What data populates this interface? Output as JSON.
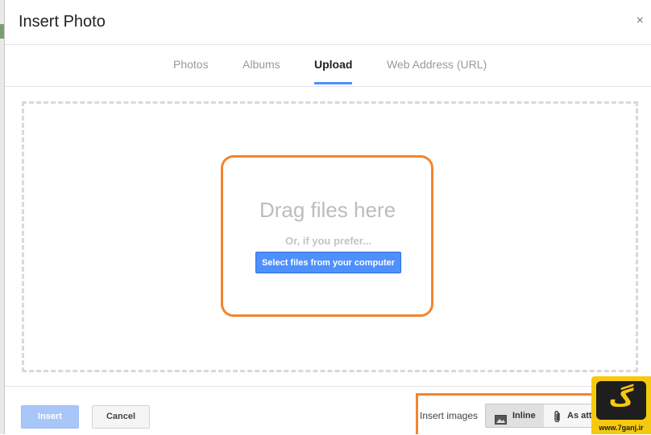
{
  "dialog": {
    "title": "Insert Photo",
    "close_glyph": "×"
  },
  "tabs": [
    {
      "label": "Photos",
      "active": false
    },
    {
      "label": "Albums",
      "active": false
    },
    {
      "label": "Upload",
      "active": true
    },
    {
      "label": "Web Address (URL)",
      "active": false
    }
  ],
  "dropzone": {
    "heading": "Drag files here",
    "alt_text": "Or, if you prefer...",
    "select_button": "Select files from your computer"
  },
  "footer": {
    "insert_button": "Insert",
    "cancel_button": "Cancel",
    "insert_images_label": "Insert images",
    "inline_option": "Inline",
    "attachment_option": "As attachment"
  },
  "watermark": {
    "glyph": "گ",
    "url": "www.7ganj.ir"
  },
  "colors": {
    "accent_blue": "#4d90fe",
    "highlight_orange": "#f2852e",
    "watermark_yellow": "#f6c90e"
  },
  "icons": [
    "close-icon",
    "image-icon",
    "paperclip-icon"
  ]
}
